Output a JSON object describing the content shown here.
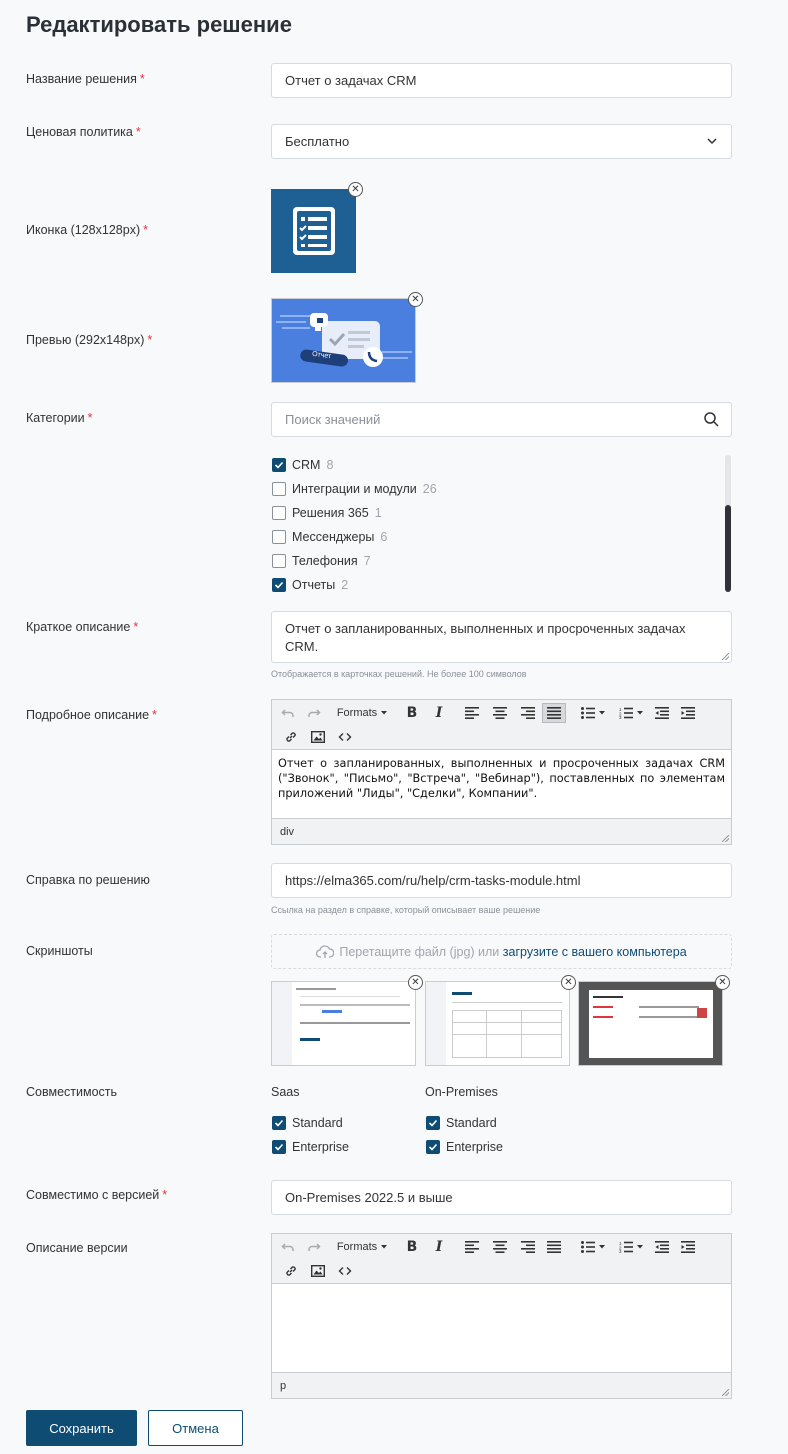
{
  "page_title": "Редактировать решение",
  "fields": {
    "name": {
      "label": "Название решения",
      "value": "Отчет о задачах CRM"
    },
    "pricing": {
      "label": "Ценовая политика",
      "value": "Бесплатно"
    },
    "icon": {
      "label": "Иконка (128x128px)"
    },
    "preview": {
      "label": "Превью (292x148px)",
      "badge_text": "Отчет"
    },
    "categories": {
      "label": "Категории",
      "search_placeholder": "Поиск значений",
      "items": [
        {
          "label": "CRM",
          "count": "8",
          "checked": true
        },
        {
          "label": "Интеграции и модули",
          "count": "26",
          "checked": false
        },
        {
          "label": "Решения 365",
          "count": "1",
          "checked": false
        },
        {
          "label": "Мессенджеры",
          "count": "6",
          "checked": false
        },
        {
          "label": "Телефония",
          "count": "7",
          "checked": false
        },
        {
          "label": "Отчеты",
          "count": "2",
          "checked": true
        }
      ]
    },
    "short_desc": {
      "label": "Краткое описание",
      "value": "Отчет о запланированных, выполненных и просроченных задачах CRM.",
      "hint": "Отображается в карточках решений. Не более 100 символов"
    },
    "long_desc": {
      "label": "Подробное описание",
      "content": "Отчет о запланированных, выполненных и просроченных задачах CRM (\"Звонок\", \"Письмо\", \"Встреча\", \"Вебинар\"), поставленных по элементам приложений \"Лиды\", \"Сделки\", Компании\".",
      "path": "div"
    },
    "help": {
      "label": "Справка по решению",
      "value": "https://elma365.com/ru/help/crm-tasks-module.html",
      "hint": "Ссылка на раздел в справке, который описывает ваше решение"
    },
    "screenshots": {
      "label": "Скриншоты",
      "drop_text": "Перетащите файл (jpg) или",
      "upload_link": "загрузите с вашего компьютера"
    },
    "compat": {
      "label": "Совместимость",
      "groups": [
        {
          "title": "Saas",
          "options": [
            {
              "label": "Standard",
              "checked": true
            },
            {
              "label": "Enterprise",
              "checked": true
            }
          ]
        },
        {
          "title": "On-Premises",
          "options": [
            {
              "label": "Standard",
              "checked": true
            },
            {
              "label": "Enterprise",
              "checked": true
            }
          ]
        }
      ]
    },
    "version": {
      "label": "Совместимо с версией",
      "value": "On-Premises 2022.5 и выше"
    },
    "version_desc": {
      "label": "Описание версии",
      "content": "",
      "path": "p"
    }
  },
  "required_mark": "*",
  "toolbar": {
    "formats_label": "Formats"
  },
  "buttons": {
    "save": "Сохранить",
    "cancel": "Отмена"
  },
  "colors": {
    "accent": "#0f4c74",
    "required": "#e2353f",
    "icon_bg": "#1e5f94",
    "preview_bg": "#4a7fe0"
  }
}
